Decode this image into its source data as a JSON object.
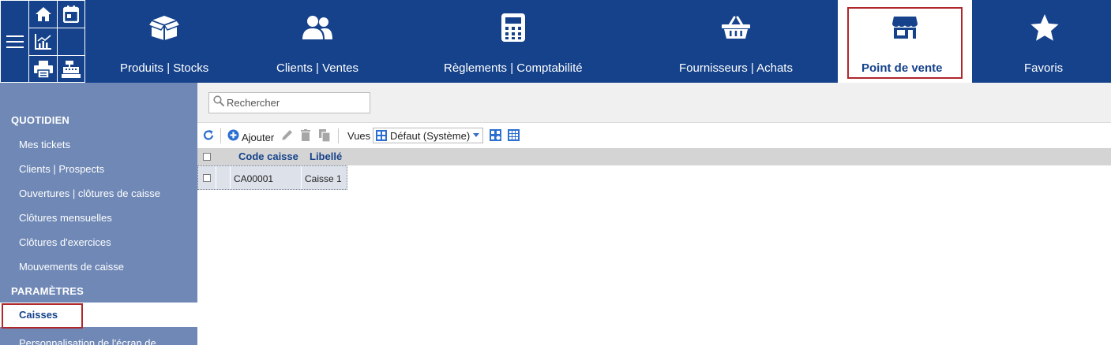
{
  "quick_access": {
    "menu_icon": "hamburger-icon",
    "icons": [
      "home-icon",
      "calendar-icon",
      "chart-icon",
      "printer-icon",
      "cash-register-icon"
    ]
  },
  "nav": {
    "items": [
      {
        "label": "Produits | Stocks",
        "icon": "box-icon"
      },
      {
        "label": "Clients | Ventes",
        "icon": "users-icon"
      },
      {
        "label": "Règlements | Comptabilité",
        "icon": "calculator-icon"
      },
      {
        "label": "Fournisseurs | Achats",
        "icon": "basket-icon"
      },
      {
        "label": "Point de vente",
        "icon": "store-icon",
        "active": true
      },
      {
        "label": "Favoris",
        "icon": "star-icon"
      }
    ]
  },
  "sidebar": {
    "sections": [
      {
        "title": "QUOTIDIEN",
        "items": [
          "Mes tickets",
          "Clients | Prospects",
          "Ouvertures | clôtures de caisse",
          "Clôtures mensuelles",
          "Clôtures d'exercices",
          "Mouvements de caisse"
        ]
      },
      {
        "title": "PARAMÈTRES",
        "items": [
          "Caisses",
          "Personnalisation de l'écran de"
        ]
      }
    ],
    "active_item": "Caisses"
  },
  "search": {
    "placeholder": "Rechercher",
    "value": ""
  },
  "toolbar": {
    "add_label": "Ajouter",
    "views_label": "Vues",
    "views_selected": "Défaut (Système)"
  },
  "grid": {
    "columns": [
      "Code caisse",
      "Libellé"
    ],
    "rows": [
      [
        "CA00001",
        "Caisse 1"
      ]
    ]
  },
  "colors": {
    "primary": "#15428b",
    "sidebar": "#6f88b6",
    "highlight_frame": "#b0272b"
  }
}
